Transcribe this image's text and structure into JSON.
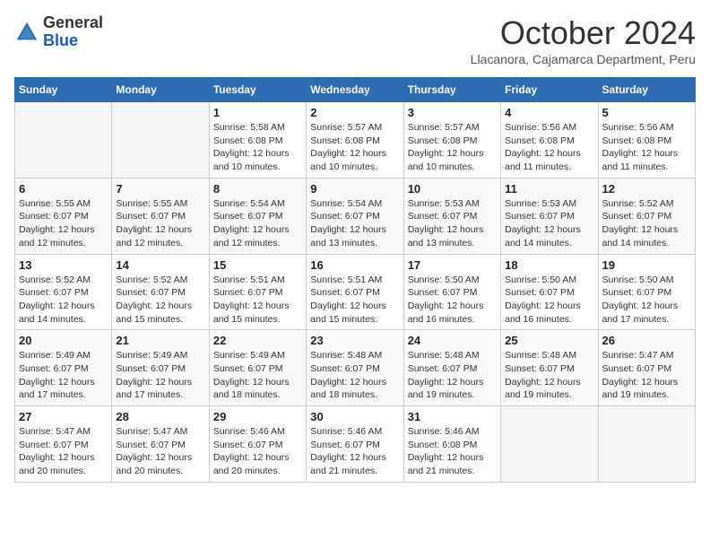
{
  "header": {
    "logo": {
      "general": "General",
      "blue": "Blue"
    },
    "title": "October 2024",
    "location": "Llacanora, Cajamarca Department, Peru"
  },
  "weekdays": [
    "Sunday",
    "Monday",
    "Tuesday",
    "Wednesday",
    "Thursday",
    "Friday",
    "Saturday"
  ],
  "weeks": [
    [
      {
        "day": "",
        "info": ""
      },
      {
        "day": "",
        "info": ""
      },
      {
        "day": "1",
        "info": "Sunrise: 5:58 AM\nSunset: 6:08 PM\nDaylight: 12 hours and 10 minutes."
      },
      {
        "day": "2",
        "info": "Sunrise: 5:57 AM\nSunset: 6:08 PM\nDaylight: 12 hours and 10 minutes."
      },
      {
        "day": "3",
        "info": "Sunrise: 5:57 AM\nSunset: 6:08 PM\nDaylight: 12 hours and 10 minutes."
      },
      {
        "day": "4",
        "info": "Sunrise: 5:56 AM\nSunset: 6:08 PM\nDaylight: 12 hours and 11 minutes."
      },
      {
        "day": "5",
        "info": "Sunrise: 5:56 AM\nSunset: 6:08 PM\nDaylight: 12 hours and 11 minutes."
      }
    ],
    [
      {
        "day": "6",
        "info": "Sunrise: 5:55 AM\nSunset: 6:07 PM\nDaylight: 12 hours and 12 minutes."
      },
      {
        "day": "7",
        "info": "Sunrise: 5:55 AM\nSunset: 6:07 PM\nDaylight: 12 hours and 12 minutes."
      },
      {
        "day": "8",
        "info": "Sunrise: 5:54 AM\nSunset: 6:07 PM\nDaylight: 12 hours and 12 minutes."
      },
      {
        "day": "9",
        "info": "Sunrise: 5:54 AM\nSunset: 6:07 PM\nDaylight: 12 hours and 13 minutes."
      },
      {
        "day": "10",
        "info": "Sunrise: 5:53 AM\nSunset: 6:07 PM\nDaylight: 12 hours and 13 minutes."
      },
      {
        "day": "11",
        "info": "Sunrise: 5:53 AM\nSunset: 6:07 PM\nDaylight: 12 hours and 14 minutes."
      },
      {
        "day": "12",
        "info": "Sunrise: 5:52 AM\nSunset: 6:07 PM\nDaylight: 12 hours and 14 minutes."
      }
    ],
    [
      {
        "day": "13",
        "info": "Sunrise: 5:52 AM\nSunset: 6:07 PM\nDaylight: 12 hours and 14 minutes."
      },
      {
        "day": "14",
        "info": "Sunrise: 5:52 AM\nSunset: 6:07 PM\nDaylight: 12 hours and 15 minutes."
      },
      {
        "day": "15",
        "info": "Sunrise: 5:51 AM\nSunset: 6:07 PM\nDaylight: 12 hours and 15 minutes."
      },
      {
        "day": "16",
        "info": "Sunrise: 5:51 AM\nSunset: 6:07 PM\nDaylight: 12 hours and 15 minutes."
      },
      {
        "day": "17",
        "info": "Sunrise: 5:50 AM\nSunset: 6:07 PM\nDaylight: 12 hours and 16 minutes."
      },
      {
        "day": "18",
        "info": "Sunrise: 5:50 AM\nSunset: 6:07 PM\nDaylight: 12 hours and 16 minutes."
      },
      {
        "day": "19",
        "info": "Sunrise: 5:50 AM\nSunset: 6:07 PM\nDaylight: 12 hours and 17 minutes."
      }
    ],
    [
      {
        "day": "20",
        "info": "Sunrise: 5:49 AM\nSunset: 6:07 PM\nDaylight: 12 hours and 17 minutes."
      },
      {
        "day": "21",
        "info": "Sunrise: 5:49 AM\nSunset: 6:07 PM\nDaylight: 12 hours and 17 minutes."
      },
      {
        "day": "22",
        "info": "Sunrise: 5:49 AM\nSunset: 6:07 PM\nDaylight: 12 hours and 18 minutes."
      },
      {
        "day": "23",
        "info": "Sunrise: 5:48 AM\nSunset: 6:07 PM\nDaylight: 12 hours and 18 minutes."
      },
      {
        "day": "24",
        "info": "Sunrise: 5:48 AM\nSunset: 6:07 PM\nDaylight: 12 hours and 19 minutes."
      },
      {
        "day": "25",
        "info": "Sunrise: 5:48 AM\nSunset: 6:07 PM\nDaylight: 12 hours and 19 minutes."
      },
      {
        "day": "26",
        "info": "Sunrise: 5:47 AM\nSunset: 6:07 PM\nDaylight: 12 hours and 19 minutes."
      }
    ],
    [
      {
        "day": "27",
        "info": "Sunrise: 5:47 AM\nSunset: 6:07 PM\nDaylight: 12 hours and 20 minutes."
      },
      {
        "day": "28",
        "info": "Sunrise: 5:47 AM\nSunset: 6:07 PM\nDaylight: 12 hours and 20 minutes."
      },
      {
        "day": "29",
        "info": "Sunrise: 5:46 AM\nSunset: 6:07 PM\nDaylight: 12 hours and 20 minutes."
      },
      {
        "day": "30",
        "info": "Sunrise: 5:46 AM\nSunset: 6:07 PM\nDaylight: 12 hours and 21 minutes."
      },
      {
        "day": "31",
        "info": "Sunrise: 5:46 AM\nSunset: 6:08 PM\nDaylight: 12 hours and 21 minutes."
      },
      {
        "day": "",
        "info": ""
      },
      {
        "day": "",
        "info": ""
      }
    ]
  ]
}
